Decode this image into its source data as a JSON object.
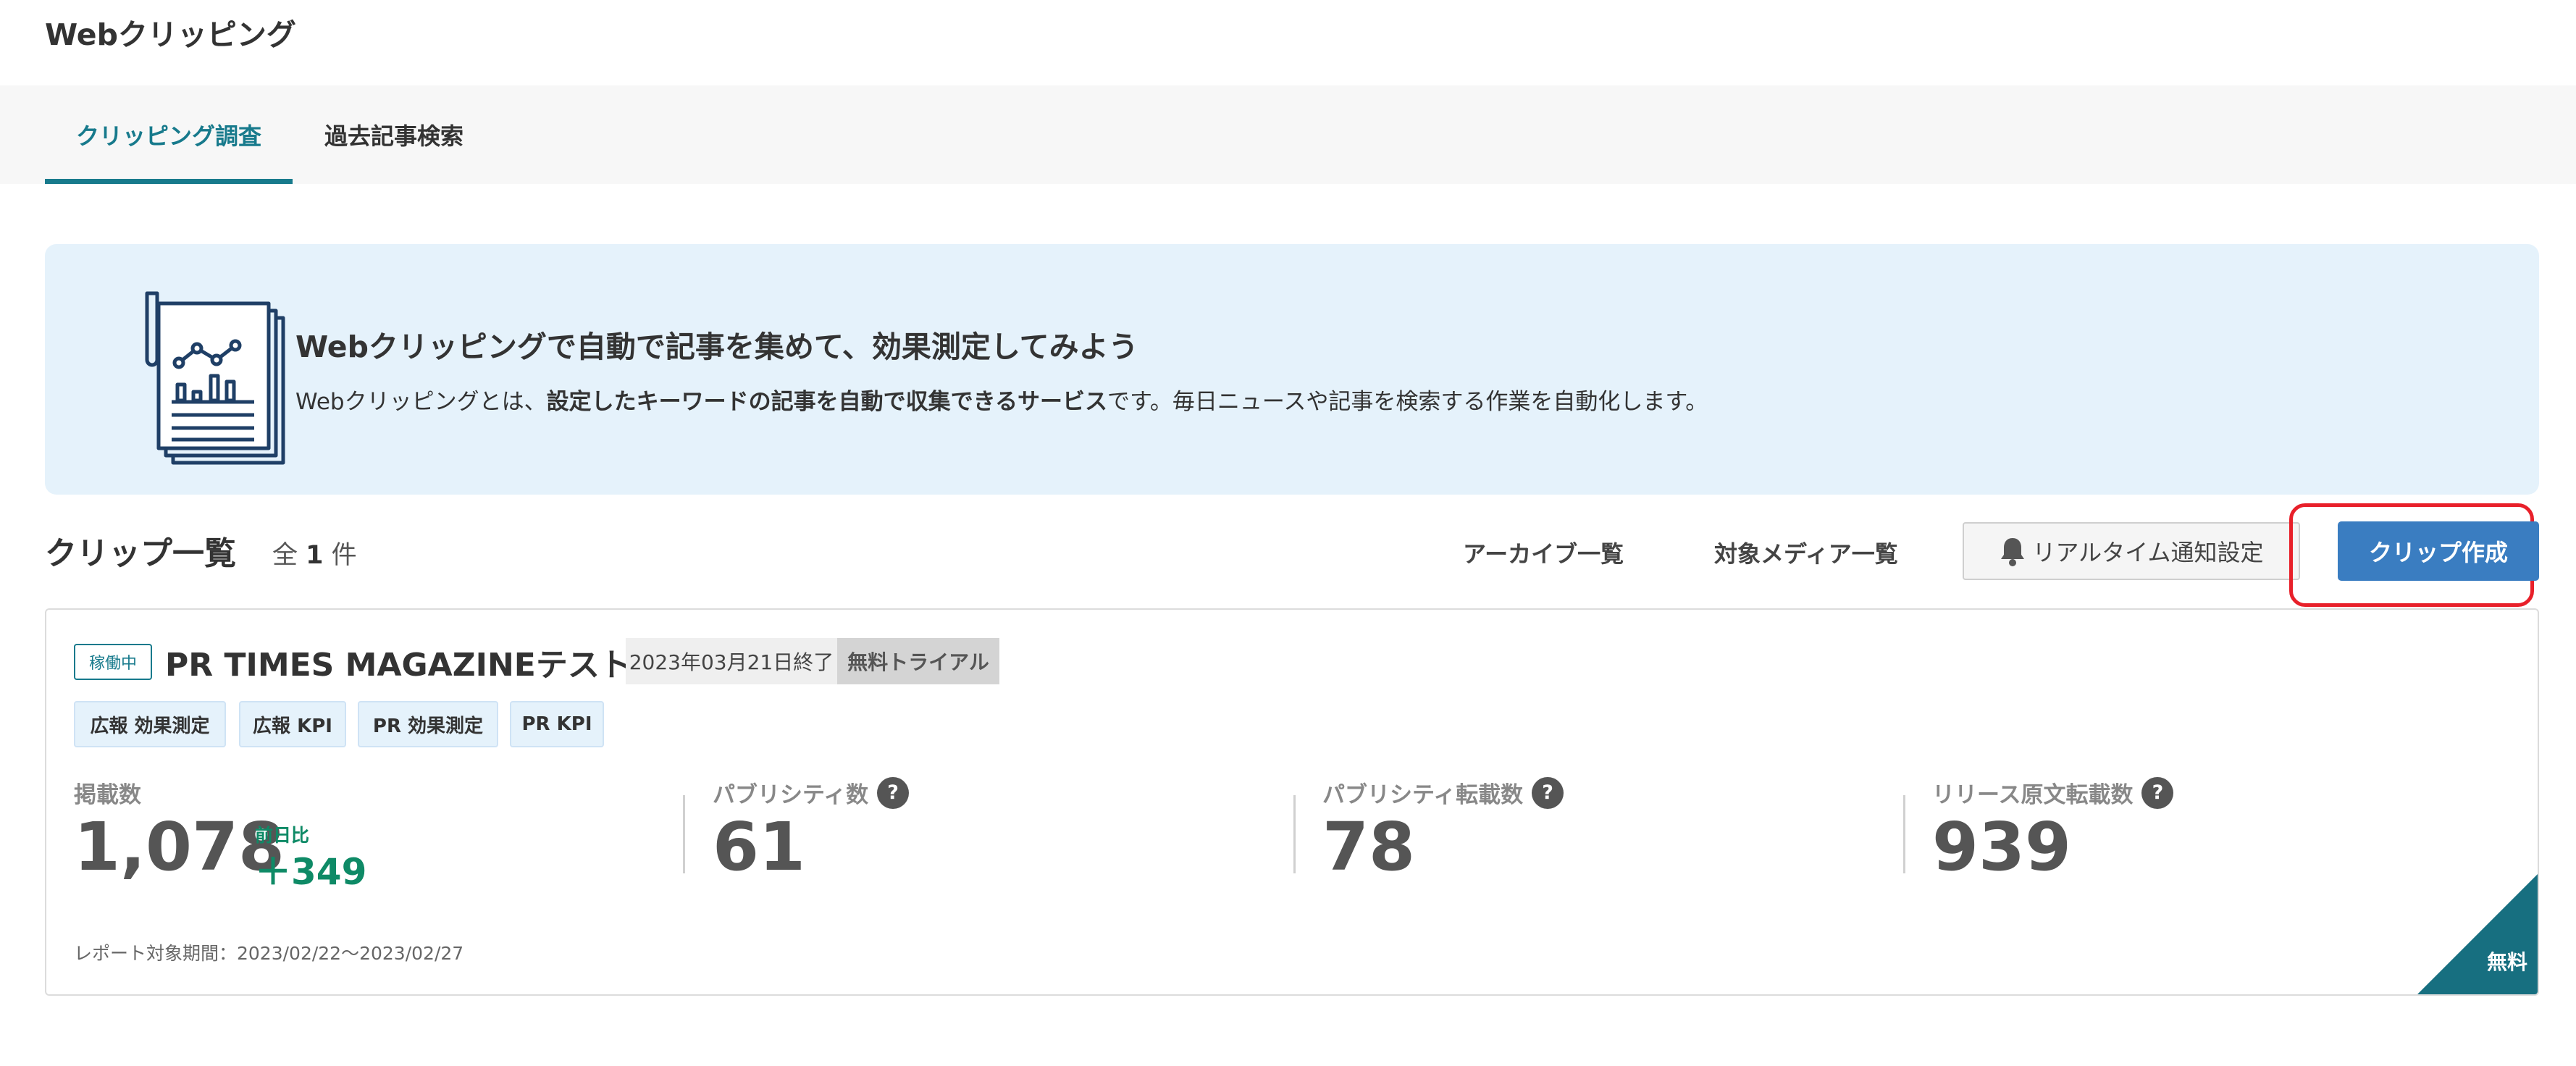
{
  "page": {
    "title": "Webクリッピング"
  },
  "tabs": [
    {
      "label": "クリッピング調査",
      "active": true
    },
    {
      "label": "過去記事検索",
      "active": false
    }
  ],
  "banner": {
    "icon": "report-chart-document-icon",
    "title": "Webクリッピングで自動で記事を集めて、効果測定してみよう",
    "desc_pre": "Webクリッピングとは、",
    "desc_bold": "設定したキーワードの記事を自動で収集できるサービス",
    "desc_post": "です。毎日ニュースや記事を検索する作業を自動化します。"
  },
  "list": {
    "title": "クリップ一覧",
    "count_prefix": "全",
    "count": "1",
    "count_suffix": "件"
  },
  "toolbar": {
    "archive_label": "アーカイブ一覧",
    "media_label": "対象メディア一覧",
    "notify_label": "リアルタイム通知設定",
    "notify_icon": "bell-icon",
    "create_label": "クリップ作成",
    "highlight_color": "#e8202a",
    "create_color": "#3a7dc1"
  },
  "clip": {
    "status": "稼働中",
    "name": "PR TIMES MAGAZINEテスト",
    "end_date": "2023年03月21日終了",
    "plan": "無料トライアル",
    "tags": [
      "広報 効果測定",
      "広報 KPI",
      "PR 効果測定",
      "PR KPI"
    ],
    "metrics": {
      "placements": {
        "label": "掲載数",
        "value": "1,078",
        "diff_label": "前日比",
        "diff_value": "＋349"
      },
      "publicity": {
        "label": "パブリシティ数",
        "value": "61"
      },
      "publicity_reprint": {
        "label": "パブリシティ転載数",
        "value": "78"
      },
      "release_reprint": {
        "label": "リリース原文転載数",
        "value": "939"
      }
    },
    "help_glyph": "?",
    "period": "レポート対象期間：2023/02/22〜2023/02/27",
    "corner_label": "無料",
    "accent_color": "#177a8c"
  }
}
